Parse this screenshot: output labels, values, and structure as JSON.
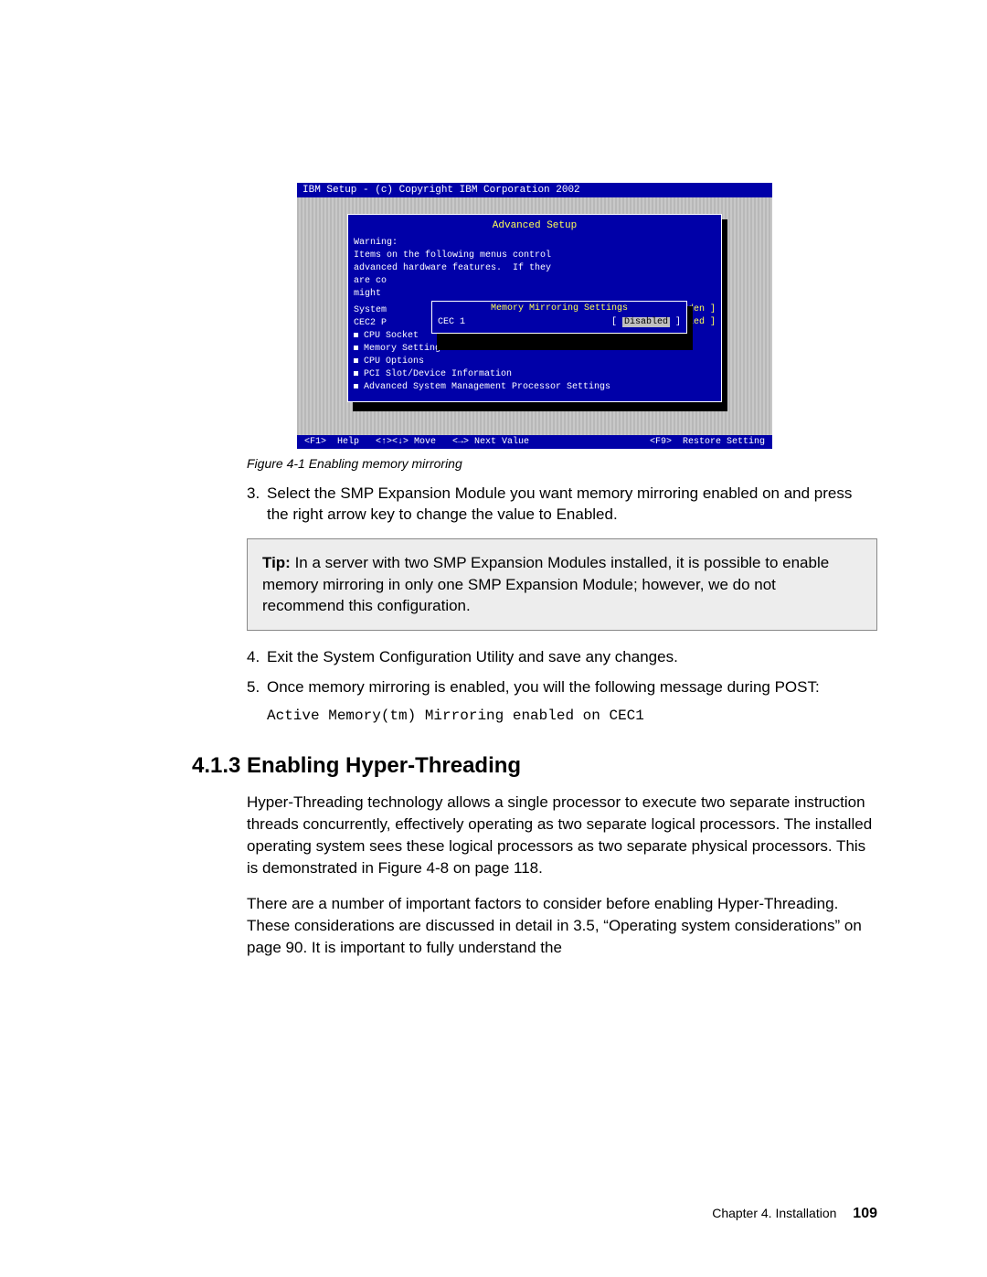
{
  "bios": {
    "title": "IBM Setup - (c) Copyright IBM Corporation 2002",
    "panel_heading": "Advanced Setup",
    "warning_lines": [
      "Warning:",
      "Items on the following menus control",
      "advanced hardware features.  If they",
      "are co",
      "might"
    ],
    "partial_lines": [
      "System",
      "CEC2 P"
    ],
    "behind_values": [
      "dden  ]",
      "abled ]"
    ],
    "menu_items": [
      "CPU Socket",
      "Memory Settings",
      "CPU Options",
      "PCI Slot/Device Information",
      "Advanced System Management Processor Settings"
    ],
    "sub_panel": {
      "heading": "Memory Mirroring Settings",
      "row_label": "CEC 1",
      "row_value": "Disabled",
      "row_value_wrap_l": "[ ",
      "row_value_wrap_r": " ]"
    },
    "footer": {
      "left": "<F1>  Help   <↑><↓> Move   <→> Next Value",
      "right": "<F9>  Restore Setting"
    }
  },
  "figure_caption": "Figure 4-1   Enabling memory mirroring",
  "step3_num": "3.",
  "step3_text": "Select the SMP Expansion Module you want memory mirroring enabled on and press the right arrow key to change the value to Enabled.",
  "tip_label": "Tip:",
  "tip_text": " In a server with two SMP Expansion Modules installed, it is possible to enable memory mirroring in only one SMP Expansion Module; however, we do not recommend this configuration.",
  "step4_num": "4.",
  "step4_text": "Exit the System Configuration Utility and save any changes.",
  "step5_num": "5.",
  "step5_text": "Once memory mirroring is enabled, you will the following message during POST:",
  "mono_line": "Active Memory(tm) Mirroring enabled on CEC1",
  "section_heading": "4.1.3  Enabling Hyper-Threading",
  "para1": "Hyper-Threading technology allows a single processor to execute two separate instruction threads concurrently, effectively operating as two separate logical processors. The installed operating system sees these logical processors as two separate physical processors. This is demonstrated in Figure 4-8 on page 118.",
  "para2": "There are a number of important factors to consider before enabling Hyper-Threading. These considerations are discussed in detail in 3.5, “Operating system considerations” on page 90. It is important to fully understand the",
  "footer_chapter": "Chapter 4. Installation",
  "footer_page": "109"
}
